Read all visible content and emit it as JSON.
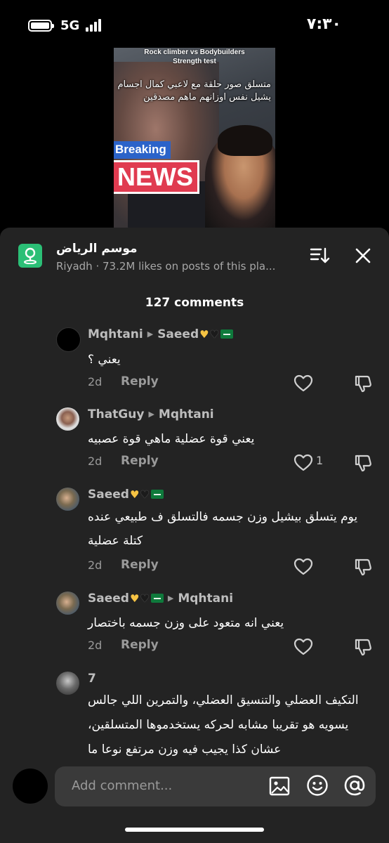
{
  "status_bar": {
    "network": "5G",
    "time": "٧:٣٠"
  },
  "video": {
    "top_caption_line1": "Rock climber vs Bodybuilders",
    "top_caption_line2": "Strength test",
    "arabic_caption": "متسلق صور حلقة مع لاعبي كمال اجسام يشيل نفس اوزانهم ماهم مصدقين",
    "badge_breaking": "Breaking",
    "badge_news": "NEWS"
  },
  "place": {
    "title": "موسم الرياض",
    "subtitle": "Riyadh · 73.2M likes on posts of this pla...",
    "icon": "location-pin-icon"
  },
  "comments_header": "127 comments",
  "comments": [
    {
      "author": "Mqhtani",
      "reply_to": "Saeed",
      "text": "يعني ؟",
      "age": "2d",
      "reply_label": "Reply",
      "likes": ""
    },
    {
      "author": "ThatGuy",
      "reply_to": "Mqhtani",
      "text": "يعني قوة عضلية ماهي قوة عصبيه",
      "age": "2d",
      "reply_label": "Reply",
      "likes": "1"
    },
    {
      "author": "Saeed",
      "reply_to": "",
      "text": "يوم يتسلق بيشيل وزن جسمه فالتسلق ف طبيعي عنده كتلة عضلية",
      "age": "2d",
      "reply_label": "Reply",
      "likes": ""
    },
    {
      "author": "Saeed",
      "reply_to": "Mqhtani",
      "text": "يعني انه متعود على وزن جسمه باختصار",
      "age": "2d",
      "reply_label": "Reply",
      "likes": ""
    },
    {
      "author": "7",
      "reply_to": "",
      "text_line1": "التكيف العضلي والتنسيق العضلي، والتمرين اللي جالس",
      "text_line2": "يسويه هو تقريبا مشابه لحركه يستخدموها المتسلقين،",
      "text_line3": "عشان كذا يجيب فيه وزن مرتفع نوعا ما"
    }
  ],
  "composer": {
    "placeholder": "Add comment..."
  },
  "colors": {
    "sheet_bg": "#232323",
    "place_icon": "#2bbf76",
    "input_bg": "#3a3a3a",
    "breaking_blue": "#2b63c9",
    "news_red": "#e03b50"
  }
}
